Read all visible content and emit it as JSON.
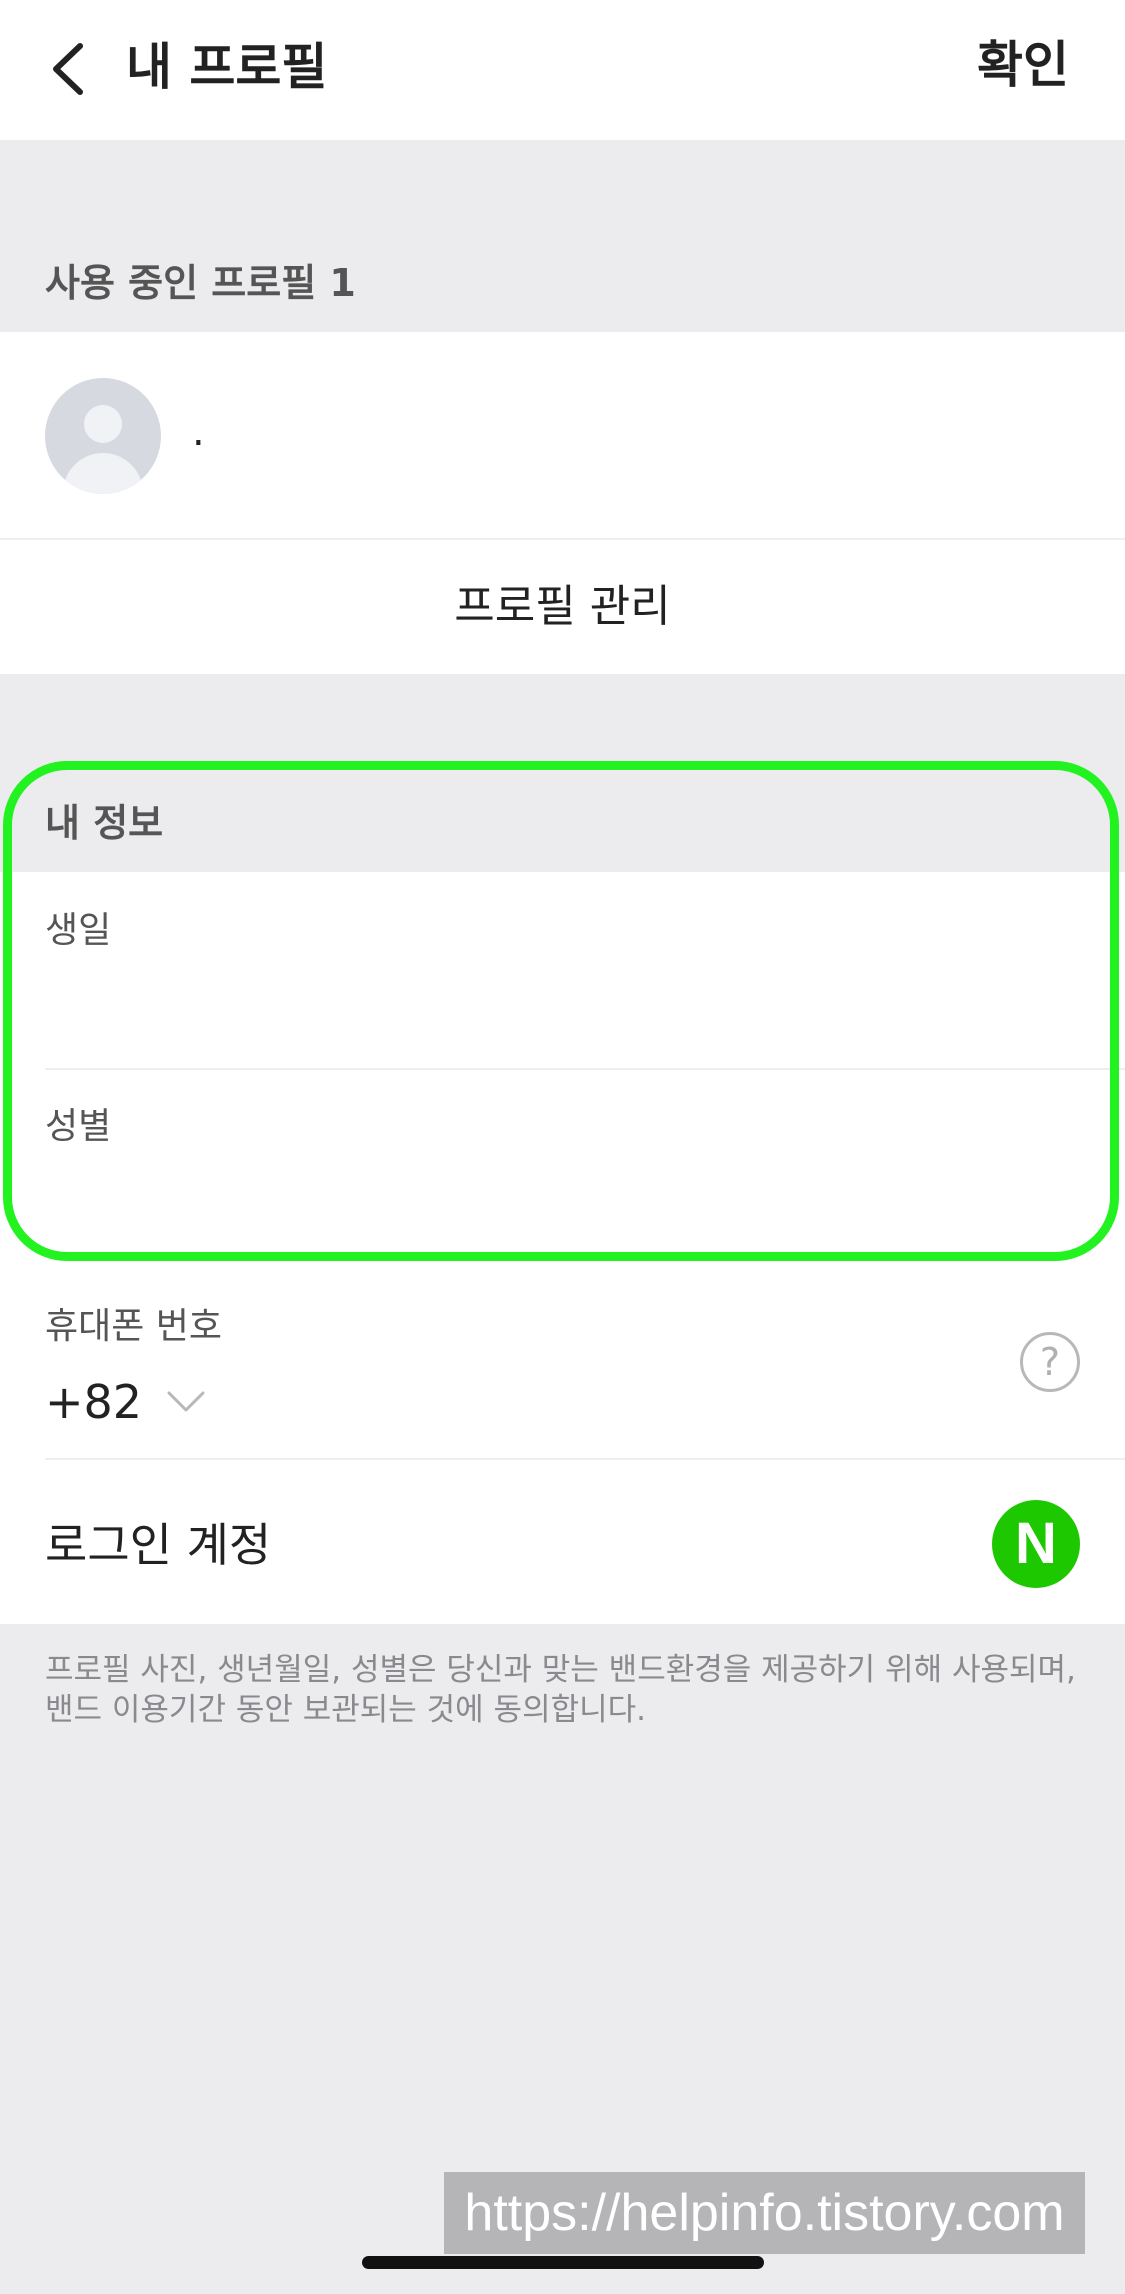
{
  "header": {
    "title": "내 프로필",
    "confirm_label": "확인"
  },
  "profile_section": {
    "label": "사용 중인 프로필 1",
    "name": ".",
    "manage_label": "프로필 관리"
  },
  "my_info": {
    "label": "내 정보",
    "fields": [
      {
        "label": "생일"
      },
      {
        "label": "성별"
      }
    ],
    "highlight_color": "#22f21f"
  },
  "contact": {
    "phone_label": "휴대폰 번호",
    "country_code": "+82",
    "help_glyph": "?",
    "login_label": "로그인 계정",
    "login_provider_glyph": "N",
    "login_provider_color": "#1ec800"
  },
  "notice": "프로필 사진, 생년월일, 성별은 당신과 맞는 밴드환경을 제공하기 위해 사용되며, 밴드 이용기간 동안 보관되는 것에 동의합니다.",
  "watermark": "https://helpinfo.tistory.com"
}
